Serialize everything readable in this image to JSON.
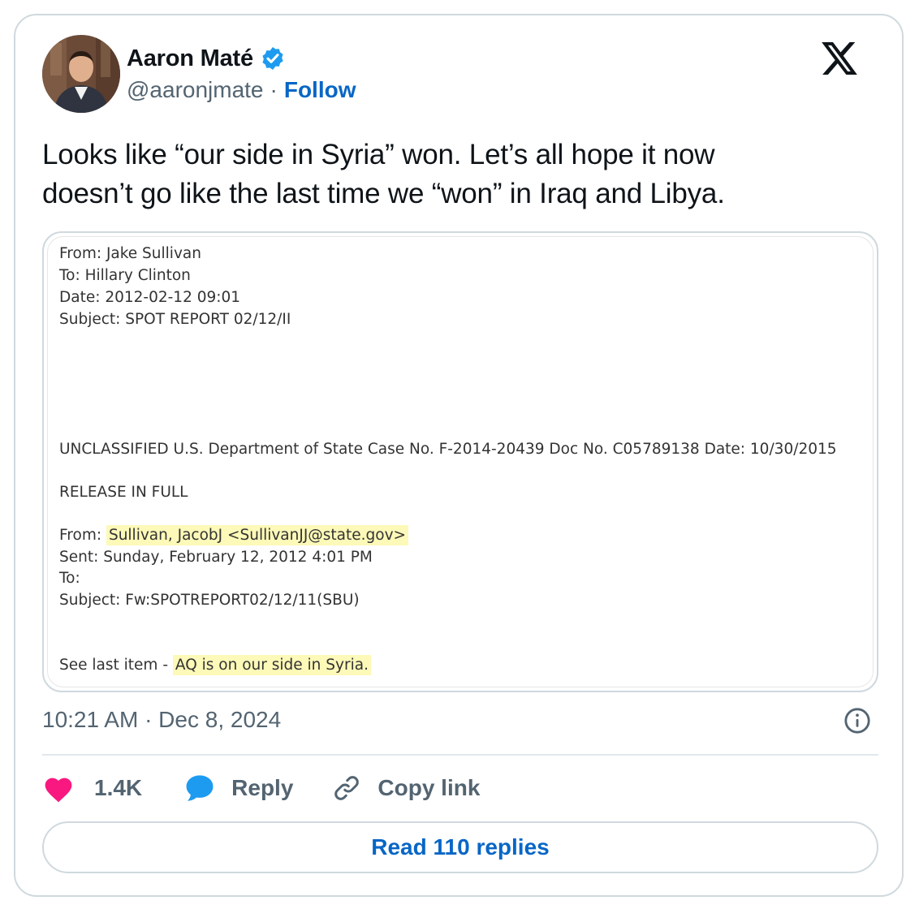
{
  "author": {
    "name": "Aaron Maté",
    "handle": "@aaronjmate",
    "separator": "·",
    "follow_label": "Follow"
  },
  "tweet": {
    "text_line1": "Looks like “our side in Syria” won. Let’s all hope it now",
    "text_line2": "doesn’t go like the last time we “won” in Iraq and Libya."
  },
  "document": {
    "from": "From: Jake Sullivan",
    "to": "To: Hillary Clinton",
    "date": "Date: 2012-02-12 09:01",
    "subject": "Subject: SPOT REPORT 02/12/II",
    "classification": "UNCLASSIFIED U.S. Department of State Case No. F-2014-20439 Doc No. C05789138 Date: 10/30/2015",
    "release": "RELEASE IN FULL",
    "email_from_label": "From: ",
    "email_from_value": "Sullivan, JacobJ <SullivanJJ@state.gov>",
    "email_sent": "Sent: Sunday, February 12, 2012 4:01 PM",
    "email_to": "To:",
    "email_subject": "Subject: Fw:SPOTREPORT02/12/11(SBU)",
    "note_prefix": "See last item - ",
    "note_highlight": "AQ is on our side in Syria."
  },
  "meta": {
    "timestamp": "10:21 AM · Dec 8, 2024"
  },
  "actions": {
    "likes": "1.4K",
    "reply_label": "Reply",
    "copy_label": "Copy link"
  },
  "read_replies_label": "Read 110 replies",
  "colors": {
    "accent": "#0866c6",
    "like": "#f91880",
    "reply": "#1d9bf0",
    "verified": "#1d9bf0",
    "highlight": "#fdf9b8",
    "border": "#cfd9de",
    "secondary_text": "#536471"
  },
  "icons": {
    "verified": "verified-badge-icon",
    "platform": "x-logo-icon",
    "info": "info-icon",
    "like": "heart-icon",
    "reply": "speech-bubble-icon",
    "copy": "link-icon"
  }
}
